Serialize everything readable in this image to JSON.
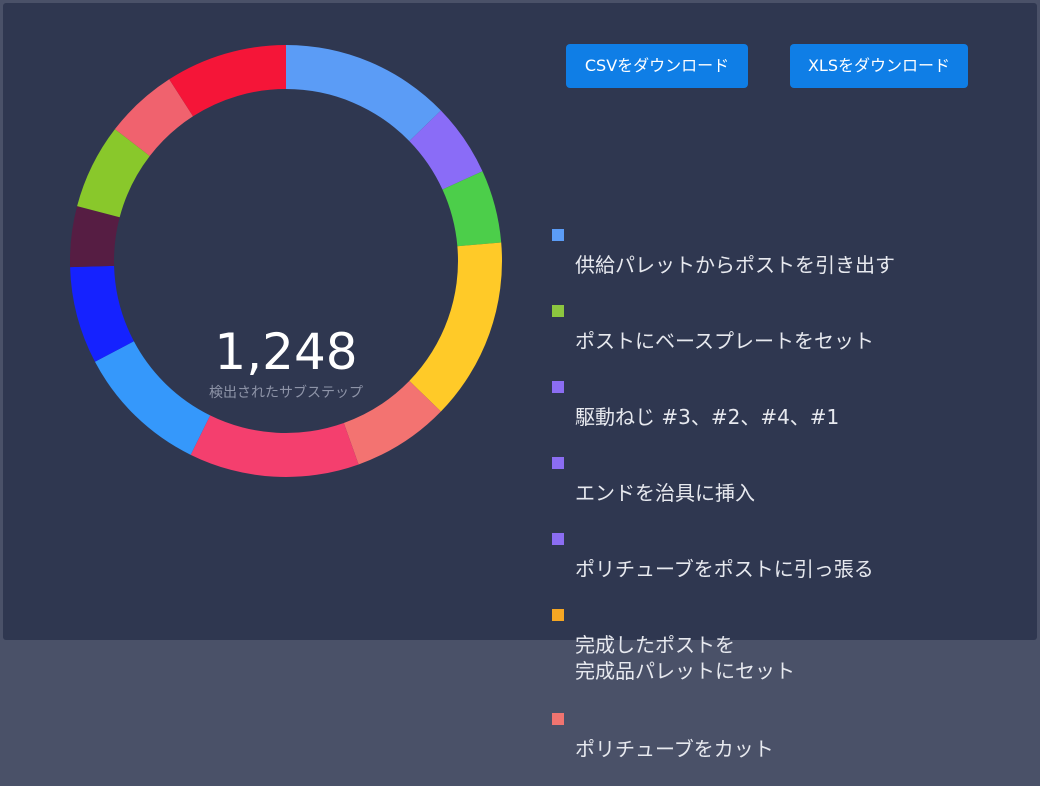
{
  "buttons": {
    "csv_label": "CSVをダウンロード",
    "xls_label": "XLSをダウンロード"
  },
  "center": {
    "value": "1,248",
    "caption": "検出されたサブステップ"
  },
  "legend": [
    {
      "label": "供給パレットからポストを引き出す",
      "color": "#5b9cf6"
    },
    {
      "label": "ポストにベースプレートをセット",
      "color": "#8cc63f"
    },
    {
      "label": "駆動ねじ #3、#2、#4、#1",
      "color": "#8b6df2"
    },
    {
      "label": "エンドを治具に挿入",
      "color": "#8b6df2"
    },
    {
      "label": "ポリチューブをポストに引っ張る",
      "color": "#8b6df2"
    },
    {
      "label": "完成したポストを\n完成品パレットにセット",
      "color": "#f5a623"
    },
    {
      "label": "ポリチューブをカット",
      "color": "#f07470"
    }
  ],
  "chart_data": {
    "type": "pie",
    "subtype": "donut",
    "total_label": "1,248",
    "caption": "検出されたサブステップ",
    "segments": [
      {
        "color": "#5b9cf6",
        "value": 14
      },
      {
        "color": "#8a6cf7",
        "value": 6
      },
      {
        "color": "#4cce4a",
        "value": 6
      },
      {
        "color": "#ffca28",
        "value": 15
      },
      {
        "color": "#f37371",
        "value": 8
      },
      {
        "color": "#f43f6e",
        "value": 14
      },
      {
        "color": "#3598fb",
        "value": 11
      },
      {
        "color": "#1522ff",
        "value": 8
      },
      {
        "color": "#561d43",
        "value": 5
      },
      {
        "color": "#89c82b",
        "value": 7
      },
      {
        "color": "#f0626e",
        "value": 6
      },
      {
        "color": "#f51538",
        "value": 10
      }
    ]
  }
}
